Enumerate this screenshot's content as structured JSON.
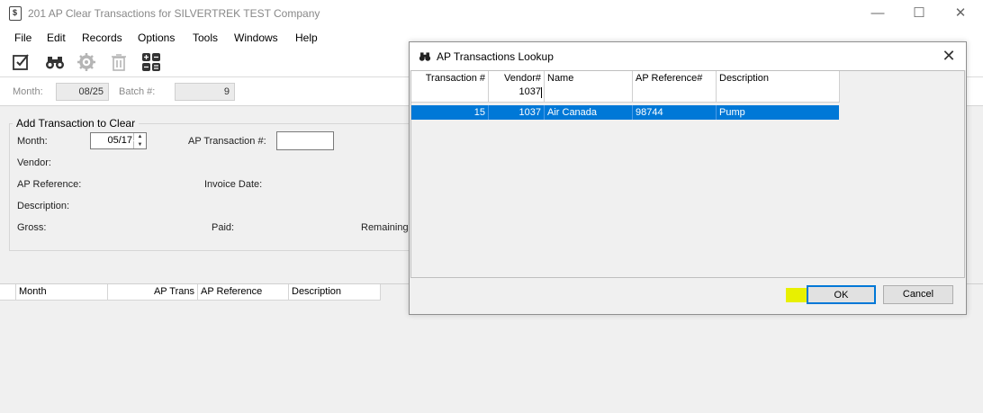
{
  "window": {
    "title": "201 AP Clear Transactions for SILVERTREK TEST Company",
    "minimize_glyph": "—",
    "maximize_glyph": "☐",
    "close_glyph": "✕"
  },
  "menu": [
    "File",
    "Edit",
    "Records",
    "Options",
    "Tools",
    "Windows",
    "Help"
  ],
  "toolbar": [
    "edit-checkbox-icon",
    "binoculars-icon",
    "gear-icon",
    "trash-icon",
    "calculator-icon"
  ],
  "batch": {
    "month_label": "Month:",
    "month_value": "08/25",
    "batch_label": "Batch #:",
    "batch_value": "9"
  },
  "add_group": {
    "title": "Add Transaction to Clear",
    "month_label": "Month:",
    "month_value": "05/17",
    "ap_trans_label": "AP Transaction #:",
    "ap_trans_value": "",
    "vendor_label": "Vendor:",
    "ap_ref_label": "AP Reference:",
    "invoice_date_label": "Invoice Date:",
    "description_label": "Description:",
    "gross_label": "Gross:",
    "paid_label": "Paid:",
    "remaining_label": "Remaining:"
  },
  "grid": {
    "headers": [
      "Month",
      "AP Trans",
      "AP Reference",
      "Description"
    ]
  },
  "dialog": {
    "title": "AP Transactions Lookup",
    "close_glyph": "✕",
    "columns": [
      "Transaction #",
      "Vendor#",
      "Name",
      "AP Reference#",
      "Description"
    ],
    "filters": {
      "transaction": "",
      "vendor": "1037",
      "name": "",
      "ap_reference": "",
      "description": ""
    },
    "rows": [
      {
        "transaction": "15",
        "vendor": "1037",
        "name": "Air Canada",
        "ap_reference": "98744",
        "description": "Pump",
        "selected": true
      }
    ],
    "ok_label": "OK",
    "cancel_label": "Cancel"
  },
  "colors": {
    "selection": "#0078d7",
    "highlight": "#e8f000",
    "button_focus": "#0078d7"
  }
}
